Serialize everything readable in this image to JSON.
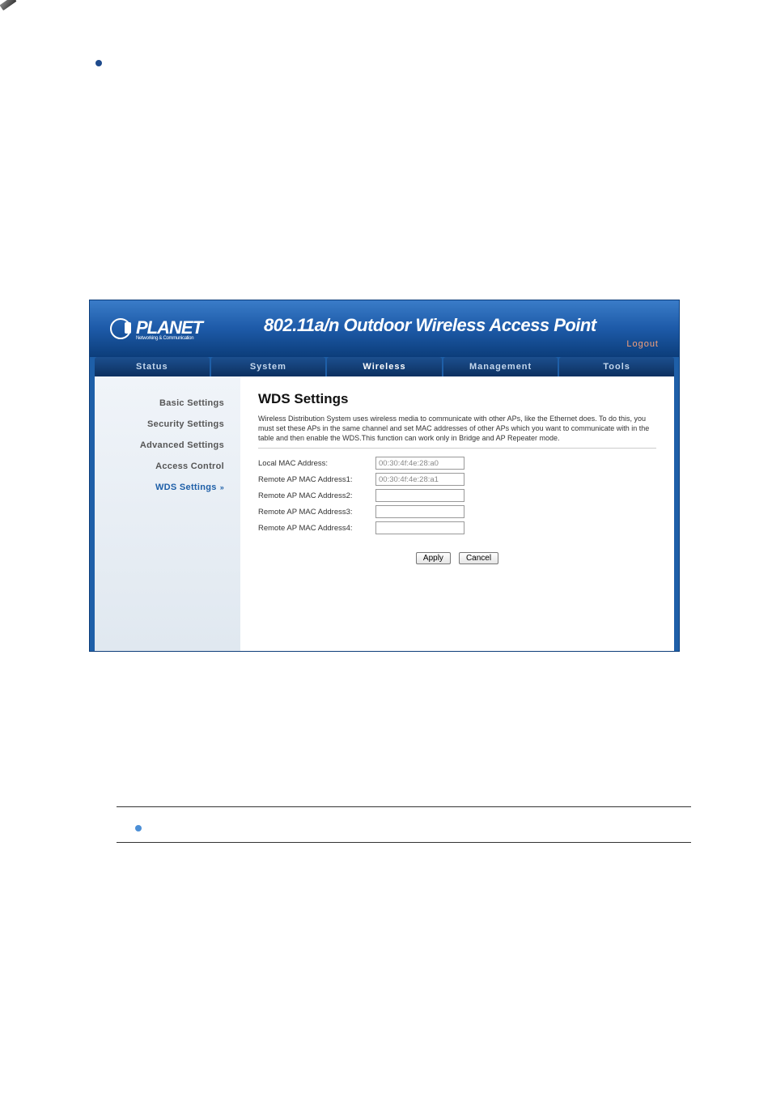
{
  "logo": {
    "brand": "PLANET",
    "tagline": "Networking & Communication"
  },
  "banner": {
    "title": "802.11a/n Outdoor Wireless Access Point",
    "logout": "Logout"
  },
  "tabs": [
    "Status",
    "System",
    "Wireless",
    "Management",
    "Tools"
  ],
  "sidebar": {
    "items": [
      {
        "label": "Basic Settings"
      },
      {
        "label": "Security Settings"
      },
      {
        "label": "Advanced Settings"
      },
      {
        "label": "Access Control"
      },
      {
        "label": "WDS Settings"
      }
    ]
  },
  "main": {
    "heading": "WDS Settings",
    "description": "Wireless Distribution System uses wireless media to communicate with other APs, like the Ethernet does. To do this, you must set these APs in the same channel and set MAC addresses of other APs which you want to communicate with in the table and then enable the WDS.This function can work only in Bridge and AP Repeater mode.",
    "fields": [
      {
        "label": "Local MAC Address:",
        "value": "00:30:4f:4e:28:a0"
      },
      {
        "label": "Remote AP MAC Address1:",
        "value": "00:30:4f:4e:28:a1"
      },
      {
        "label": "Remote AP MAC Address2:",
        "value": ""
      },
      {
        "label": "Remote AP MAC Address3:",
        "value": ""
      },
      {
        "label": "Remote AP MAC Address4:",
        "value": ""
      }
    ],
    "buttons": {
      "apply": "Apply",
      "cancel": "Cancel"
    }
  }
}
